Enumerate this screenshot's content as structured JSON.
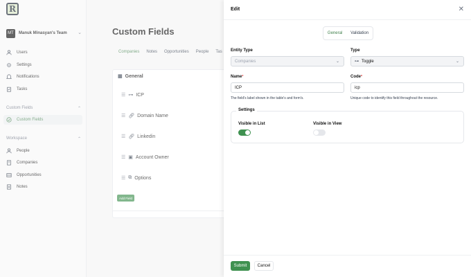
{
  "logo": "R",
  "team": {
    "initials": "MT",
    "name": "Manuk Minasyan's Team"
  },
  "nav": {
    "users": "Users",
    "settings": "Settings",
    "notifications": "Notifications",
    "tasks": "Tasks"
  },
  "sections": {
    "custom_fields": "Custom Fields",
    "workspace": "Workspace"
  },
  "custom_fields_item": "Custom Fields",
  "workspace_items": {
    "people": "People",
    "companies": "Companies",
    "opportunities": "Opportunities",
    "notes": "Notes"
  },
  "main": {
    "title": "Custom Fields",
    "tabs": [
      "Companies",
      "Notes",
      "Opportunities",
      "People",
      "Tas"
    ],
    "card_title": "General",
    "rows": [
      "ICP",
      "Domain Name",
      "Linkedin",
      "Account Owner",
      "Options"
    ],
    "add_field": "Add Field"
  },
  "panel": {
    "title": "Edit",
    "tab_general": "General",
    "tab_validation": "Validation",
    "entity_type_label": "Entity Type",
    "entity_type_value": "Companies",
    "type_label": "Type",
    "type_value": "Toggle",
    "name_label": "Name",
    "name_value": "ICP",
    "name_help": "The field's label shown in the table's and form's.",
    "code_label": "Code",
    "code_value": "icp",
    "code_help": "Unique code to identify this field throughout the resource.",
    "settings_label": "Settings",
    "visible_in_list": "Visible in List",
    "visible_in_view": "Visible in View",
    "visible_in_list_on": true,
    "visible_in_view_on": false,
    "submit": "Submit",
    "cancel": "Cancel"
  },
  "colors": {
    "accent": "#3f9150",
    "active_text": "#3f7f4a"
  }
}
